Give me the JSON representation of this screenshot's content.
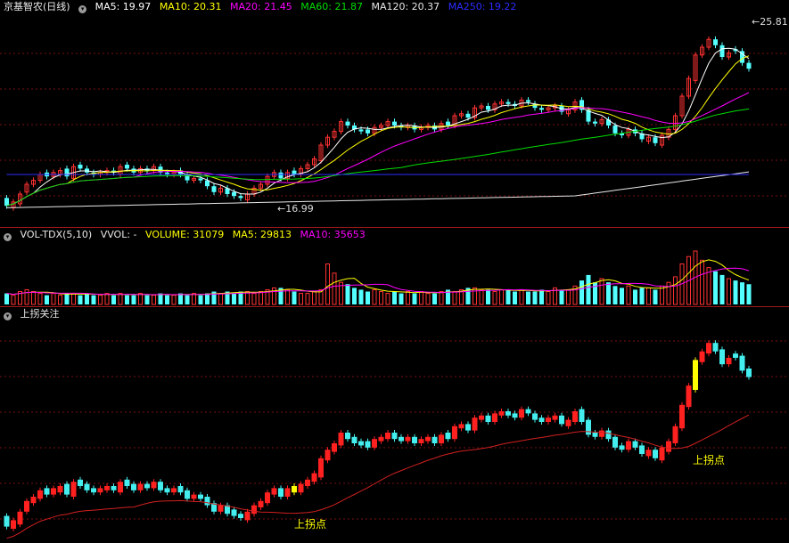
{
  "panel1": {
    "stock": "京基智农(日线)",
    "ma": [
      {
        "label": "MA5: 19.97",
        "color": "#ffffff"
      },
      {
        "label": "MA10: 20.31",
        "color": "#ffff00"
      },
      {
        "label": "MA20: 21.45",
        "color": "#ff00ff"
      },
      {
        "label": "MA60: 21.87",
        "color": "#00dd00"
      },
      {
        "label": "MA120: 20.37",
        "color": "#e8e8e8"
      },
      {
        "label": "MA250: 19.22",
        "color": "#2b2bff"
      }
    ],
    "high_label": "25.81",
    "low_label": "16.99"
  },
  "panel2": {
    "title": "VOL-TDX(5,10)",
    "vvol": "VVOL: -",
    "volume": "VOLUME: 31079",
    "ma5": "MA5: 29813",
    "ma10": "MA10: 35653",
    "colors": {
      "volume": "#ffff00",
      "ma5": "#ffff00",
      "ma10": "#ff00ff"
    }
  },
  "panel3": {
    "title": "上拐关注",
    "signal_label": "上拐点"
  },
  "chart_data": {
    "type": "candlestick",
    "close": [
      16.9,
      17.1,
      17.5,
      18.0,
      18.2,
      18.5,
      18.4,
      18.6,
      18.7,
      18.4,
      18.9,
      18.8,
      18.6,
      18.5,
      18.6,
      18.7,
      18.6,
      18.9,
      18.8,
      18.6,
      18.8,
      18.7,
      18.9,
      18.6,
      18.5,
      18.6,
      18.5,
      18.2,
      18.3,
      18.2,
      17.9,
      17.6,
      17.8,
      17.5,
      17.4,
      17.3,
      17.5,
      17.8,
      18.0,
      18.4,
      18.6,
      18.3,
      18.6,
      18.5,
      18.8,
      19.0,
      19.3,
      20.0,
      20.4,
      20.7,
      21.2,
      21.0,
      20.8,
      20.7,
      20.6,
      20.9,
      21.0,
      21.2,
      21.0,
      20.9,
      21.0,
      20.8,
      20.9,
      21.0,
      20.8,
      21.1,
      21.0,
      21.5,
      21.6,
      21.4,
      21.9,
      22.0,
      21.8,
      22.1,
      22.2,
      22.1,
      22.0,
      22.3,
      22.2,
      21.9,
      21.8,
      21.9,
      22.0,
      21.7,
      21.8,
      22.2,
      21.8,
      21.2,
      21.1,
      21.3,
      21.0,
      20.6,
      20.5,
      20.8,
      20.6,
      20.3,
      20.4,
      20.1,
      20.5,
      20.8,
      21.5,
      22.5,
      23.4,
      24.6,
      25.0,
      25.4,
      25.1,
      24.5,
      24.7,
      24.8,
      24.2,
      23.9
    ],
    "open": [
      17.3,
      16.8,
      17.0,
      17.6,
      18.0,
      18.2,
      18.6,
      18.4,
      18.5,
      18.8,
      18.3,
      19.0,
      18.8,
      18.6,
      18.5,
      18.6,
      18.7,
      18.5,
      19.0,
      18.8,
      18.6,
      18.8,
      18.7,
      18.9,
      18.6,
      18.5,
      18.7,
      18.5,
      18.2,
      18.3,
      18.2,
      17.9,
      17.6,
      17.8,
      17.6,
      17.4,
      17.2,
      17.5,
      17.8,
      18.0,
      18.4,
      18.6,
      18.3,
      18.7,
      18.5,
      18.8,
      19.0,
      19.2,
      20.0,
      20.4,
      20.7,
      21.2,
      21.0,
      20.8,
      20.8,
      20.6,
      20.9,
      21.0,
      21.2,
      21.0,
      20.9,
      21.0,
      20.8,
      20.9,
      21.0,
      20.8,
      21.2,
      21.0,
      21.5,
      21.6,
      21.4,
      21.9,
      22.0,
      21.8,
      22.1,
      22.2,
      22.1,
      22.0,
      22.3,
      22.1,
      21.9,
      21.8,
      21.9,
      22.0,
      21.6,
      21.8,
      22.3,
      21.8,
      21.2,
      21.1,
      21.3,
      21.0,
      20.6,
      20.5,
      20.8,
      20.6,
      20.2,
      20.4,
      20.0,
      20.4,
      20.8,
      21.5,
      22.5,
      23.3,
      24.6,
      25.0,
      25.4,
      25.1,
      24.5,
      24.9,
      24.8,
      24.2
    ],
    "volume": [
      6,
      5,
      7,
      8,
      7,
      6,
      5,
      6,
      5,
      6,
      6,
      5,
      6,
      5,
      5,
      6,
      5,
      6,
      5,
      5,
      6,
      5,
      5,
      6,
      5,
      5,
      6,
      5,
      6,
      5,
      6,
      7,
      6,
      7,
      6,
      7,
      7,
      6,
      7,
      8,
      9,
      9,
      8,
      7,
      6,
      6,
      7,
      8,
      22,
      17,
      12,
      11,
      9,
      8,
      7,
      8,
      7,
      6,
      7,
      6,
      7,
      6,
      7,
      6,
      6,
      7,
      8,
      7,
      8,
      9,
      9,
      8,
      8,
      7,
      8,
      8,
      7,
      8,
      7,
      7,
      8,
      7,
      9,
      8,
      8,
      10,
      13,
      16,
      12,
      14,
      12,
      10,
      9,
      10,
      8,
      9,
      9,
      8,
      10,
      12,
      15,
      22,
      26,
      29,
      24,
      20,
      18,
      16,
      14,
      13,
      12,
      11
    ],
    "y_range": [
      16.5,
      26.5
    ],
    "ma_series": [
      "MA5",
      "MA10",
      "MA20",
      "MA60",
      "MA120",
      "MA250"
    ]
  }
}
